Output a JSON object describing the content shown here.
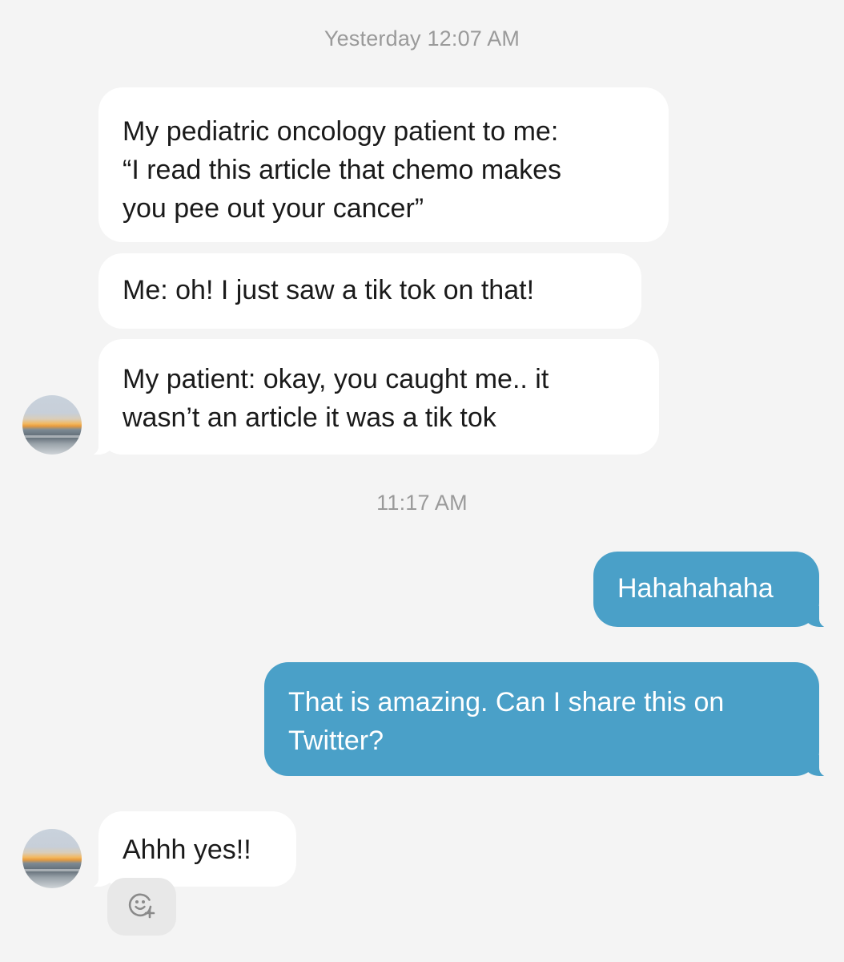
{
  "timestamps": {
    "first": "Yesterday 12:07 AM",
    "second": "11:17 AM"
  },
  "messages": [
    {
      "direction": "incoming",
      "text": "My pediatric oncology patient to me:\n“I read this article that chemo makes\nyou pee out your cancer”"
    },
    {
      "direction": "incoming",
      "text": "Me: oh! I just saw a tik tok on that!"
    },
    {
      "direction": "incoming",
      "text": "My patient: okay, you caught me.. it\nwasn’t an article it was a tik tok"
    },
    {
      "direction": "outgoing",
      "text": "Hahahahaha"
    },
    {
      "direction": "outgoing",
      "text": "That is amazing. Can I share this on\nTwitter?"
    },
    {
      "direction": "incoming",
      "text": "Ahhh yes!!"
    }
  ],
  "colors": {
    "background": "#f4f4f4",
    "incoming_bubble": "#ffffff",
    "outgoing_bubble": "#4aa0c8",
    "timestamp_text": "#9a9a9a"
  },
  "icons": {
    "reaction": "add-reaction-icon"
  }
}
